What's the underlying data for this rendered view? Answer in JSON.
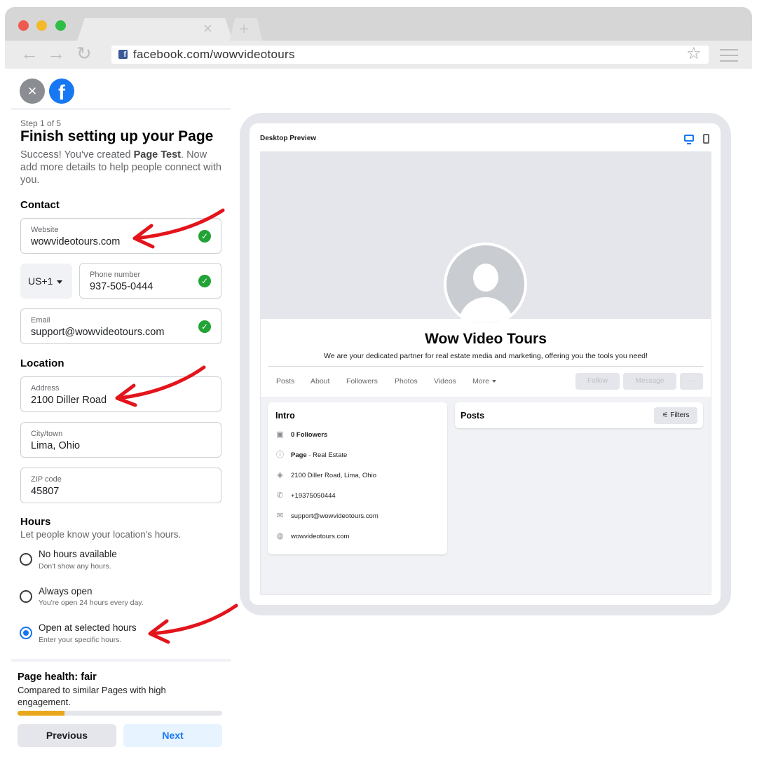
{
  "browser": {
    "url": "facebook.com/wowvideotours",
    "tab_close": "×",
    "tab_new": "+",
    "back": "←",
    "forward": "→",
    "reload": "↻",
    "star": "☆",
    "favicon": "f"
  },
  "header": {
    "close": "×",
    "logo": "f"
  },
  "wizard": {
    "step": "Step 1 of 5",
    "title": "Finish setting up your Page",
    "subtitle_pre": "Success! You've created ",
    "subtitle_bold": "Page Test",
    "subtitle_post": ". Now add more details to help people connect with you.",
    "check": "✓",
    "contact_heading": "Contact",
    "website": {
      "label": "Website",
      "value": "wowvideotours.com"
    },
    "country_code": "US+1",
    "phone": {
      "label": "Phone number",
      "value": "937-505-0444"
    },
    "email": {
      "label": "Email",
      "value": "support@wowvideotours.com"
    },
    "location_heading": "Location",
    "address": {
      "label": "Address",
      "value": "2100 Diller Road"
    },
    "city": {
      "label": "City/town",
      "value": "Lima, Ohio"
    },
    "zip": {
      "label": "ZIP code",
      "value": "45807"
    },
    "hours_heading": "Hours",
    "hours_sub": "Let people know your location's hours.",
    "hours_options": [
      {
        "title": "No hours available",
        "desc": "Don't show any hours."
      },
      {
        "title": "Always open",
        "desc": "You're open 24 hours every day."
      },
      {
        "title": "Open at selected hours",
        "desc": "Enter your specific hours."
      }
    ],
    "selected_hours_option": 2,
    "health_title": "Page health: fair",
    "health_desc": "Compared to similar Pages with high engagement.",
    "health_progress": 0.23,
    "previous_label": "Previous",
    "next_label": "Next"
  },
  "preview": {
    "label": "Desktop Preview",
    "page_name": "Wow Video Tours",
    "bio": "We are your dedicated partner for real estate media and marketing, offering you the tools you need!",
    "tabs": [
      "Posts",
      "About",
      "Followers",
      "Photos",
      "Videos",
      "More"
    ],
    "follow_label": "Follow",
    "message_label": "Message",
    "more_actions": "···",
    "intro_title": "Intro",
    "intro": {
      "followers": "0 Followers",
      "category_bold": "Page",
      "category_rest": " · Real Estate",
      "address": "2100 Diller Road, Lima, Ohio",
      "phone": "+19375050444",
      "email": "support@wowvideotours.com",
      "website": "wowvideotours.com"
    },
    "posts_title": "Posts",
    "filters_label": "Filters"
  },
  "colors": {
    "facebook_blue": "#1877f2",
    "success_green": "#21a336",
    "health_bar": "#e9a71d",
    "annotation_red": "#e3141b"
  }
}
